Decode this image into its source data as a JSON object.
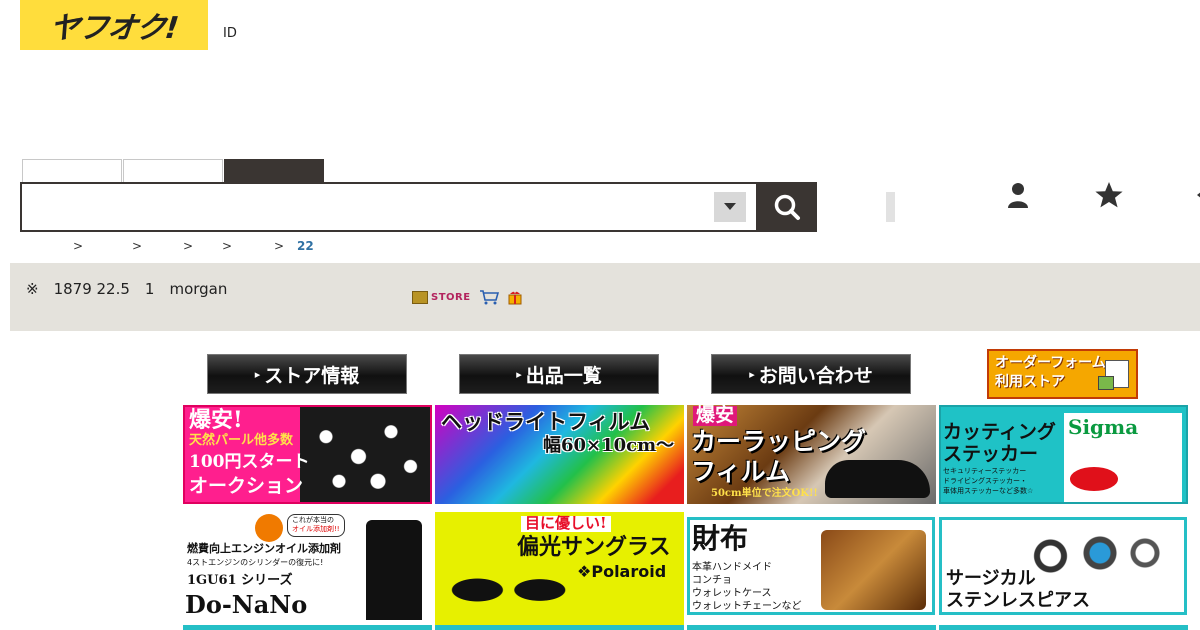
{
  "header": {
    "logo_text": "ヤフオク!",
    "id_link": "ID",
    "tabs": [
      "",
      "",
      ""
    ],
    "search": {
      "value": "",
      "placeholder": ""
    },
    "colors": {
      "brand_yellow": "#ffdd3c",
      "dark": "#3a3532",
      "link_blue": "#3172a4"
    },
    "icons": [
      "search-icon",
      "person-icon",
      "star-icon",
      "bell-icon"
    ]
  },
  "breadcrumb": {
    "separators": [
      ">",
      ">",
      ">",
      ">",
      ">"
    ],
    "current": "22"
  },
  "store": {
    "info_text": "※　1879 22.5　1　morgan",
    "badge_text": "STORE",
    "nav_buttons": [
      "ストア情報",
      "出品一覧",
      "お問い合わせ"
    ],
    "order_form_line1": "オーダーフォーム",
    "order_form_line2": "利用ストア"
  },
  "banners": {
    "b1": {
      "line1": "爆安!",
      "line2": "天然パール他多数",
      "line3": "100円スタート",
      "line4": "オークション"
    },
    "b2": {
      "line1": "ヘッドライトフィルム",
      "line2": "幅60×10cm〜"
    },
    "b3": {
      "line1": "爆安",
      "line2": "カーラッピング",
      "line3": "フィルム",
      "line4": "50cm単位で注文OK!!"
    },
    "b4": {
      "line1": "カッティング",
      "line2": "ステッカー",
      "sub1": "セキュリティーステッカー",
      "sub2": "ドライビングステッカー・",
      "sub3": "車体用ステッカーなど多数☆",
      "brand": "Sigma"
    },
    "b5": {
      "line1": "これが本当の",
      "line2": "オイル添加剤!!",
      "line3": "燃費向上エンジンオイル添加剤",
      "line4": "4ストエンジンのシリンダーの復元に!",
      "line5": "1GU61 シリーズ",
      "line6": "Do-NaNo"
    },
    "b6": {
      "line1": "目に優しい!",
      "line2": "偏光サングラス",
      "line3": "❖Polaroid"
    },
    "b7": {
      "line1": "財布",
      "sub1": "本革ハンドメイド",
      "sub2": "コンチョ",
      "sub3": "ウォレットケース",
      "sub4": "ウォレットチェーンなど"
    },
    "b8": {
      "line1": "サージカル",
      "line2": "ステンレスピアス"
    }
  }
}
